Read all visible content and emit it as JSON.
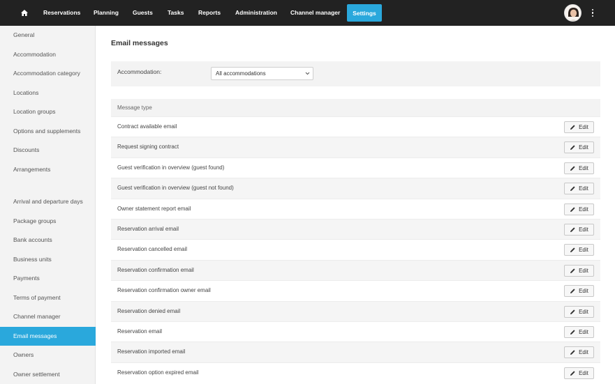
{
  "nav": {
    "home_icon": "home-icon",
    "items": [
      "Reservations",
      "Planning",
      "Guests",
      "Tasks",
      "Reports",
      "Administration",
      "Channel manager"
    ],
    "settings": "Settings",
    "menu_icon": "kebab-menu-icon",
    "accent": "#2aa8dc"
  },
  "sidebar": {
    "items": [
      "General",
      "Accommodation",
      "Accommodation category",
      "Locations",
      "Location groups",
      "Options and supplements",
      "Discounts",
      "Arrangements",
      "Arrival and departure days",
      "Package groups",
      "Bank accounts",
      "Business units",
      "Payments",
      "Terms of payment",
      "Channel manager",
      "Email messages",
      "Owners",
      "Owner settlement"
    ],
    "active": "Email messages"
  },
  "main": {
    "title": "Email messages",
    "filter_label": "Accommodation:",
    "filter_value": "All accommodations",
    "column_header": "Message type",
    "edit_label": "Edit",
    "rows": [
      "Contract available email",
      "Request signing contract",
      "Guest verification in overview (guest found)",
      "Guest verification in overview (guest not found)",
      "Owner statement report email",
      "Reservation arrival email",
      "Reservation cancelled email",
      "Reservation confirmation email",
      "Reservation confirmation owner email",
      "Reservation denied email",
      "Reservation email",
      "Reservation imported email",
      "Reservation option expired email"
    ]
  }
}
